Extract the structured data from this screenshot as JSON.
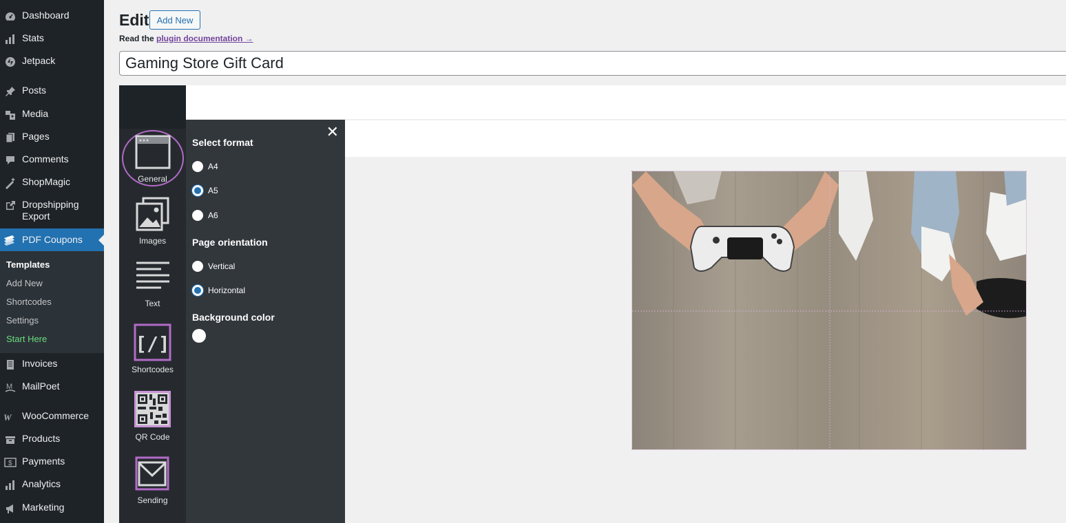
{
  "sidebar": {
    "items": [
      {
        "label": "Dashboard",
        "icon": "dashboard-icon"
      },
      {
        "label": "Stats",
        "icon": "stats-icon"
      },
      {
        "label": "Jetpack",
        "icon": "jetpack-icon"
      },
      {
        "label": "Posts",
        "icon": "pin-icon"
      },
      {
        "label": "Media",
        "icon": "media-icon"
      },
      {
        "label": "Pages",
        "icon": "pages-icon"
      },
      {
        "label": "Comments",
        "icon": "comment-icon"
      },
      {
        "label": "ShopMagic",
        "icon": "magic-wand-icon"
      },
      {
        "label": "Dropshipping\nExport",
        "icon": "external-link-icon"
      },
      {
        "label": "PDF Coupons",
        "icon": "coupons-icon"
      },
      {
        "label": "Invoices",
        "icon": "invoice-icon"
      },
      {
        "label": "MailPoet",
        "icon": "mailpoet-icon"
      },
      {
        "label": "WooCommerce",
        "icon": "woocommerce-icon"
      },
      {
        "label": "Products",
        "icon": "archive-icon"
      },
      {
        "label": "Payments",
        "icon": "dollar-icon"
      },
      {
        "label": "Analytics",
        "icon": "bar-chart-icon"
      },
      {
        "label": "Marketing",
        "icon": "megaphone-icon"
      }
    ],
    "submenu": [
      "Templates",
      "Add New",
      "Shortcodes",
      "Settings",
      "Start Here"
    ]
  },
  "header": {
    "title": "Edit",
    "add_new": "Add New",
    "doc_prefix": "Read the ",
    "doc_link": "plugin documentation →"
  },
  "post_title": "Gaming Store Gift Card",
  "tools": [
    "General",
    "Images",
    "Text",
    "Shortcodes",
    "QR Code",
    "Sending"
  ],
  "panel": {
    "format_heading": "Select format",
    "formats": [
      "A4",
      "A5",
      "A6"
    ],
    "selected_format": "A5",
    "orientation_heading": "Page orientation",
    "orientations": [
      "Vertical",
      "Horizontal"
    ],
    "selected_orientation": "Horizontal",
    "bg_heading": "Background color",
    "bg_color": "#ffffff"
  },
  "colors": {
    "admin_bg": "#1d2327",
    "accent": "#2271b1",
    "highlight_purple": "#b26bc7"
  }
}
